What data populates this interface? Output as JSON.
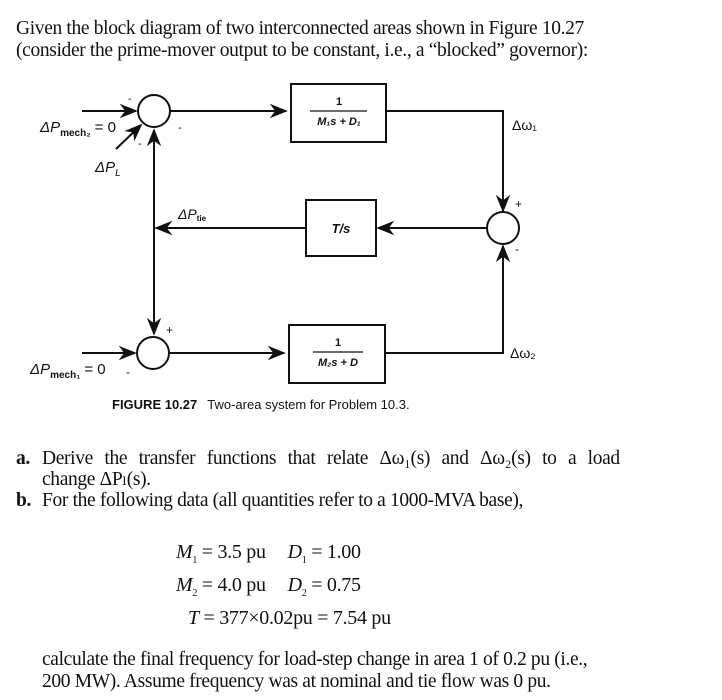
{
  "intro": {
    "line1": "Given the block diagram of two interconnected areas shown in Figure 10.27",
    "line2": "(consider the prime-mover output to be constant, i.e., a “blocked” governor):"
  },
  "diagram": {
    "blocks": {
      "area1": {
        "numerator": "1",
        "denominator": "M₁s + D₁"
      },
      "tie": {
        "label": "T/s"
      },
      "area2": {
        "numerator": "1",
        "denominator": "M₂s + D"
      }
    },
    "signals": {
      "pmech2": "ΔP",
      "pmech2_sub": "mech₂",
      "pmech2_val": "= 0",
      "pload": "ΔP",
      "pload_sub": "L",
      "ptie": "ΔP",
      "ptie_sub": "tie",
      "omega1": "Δω₁",
      "omega2": "Δω₂",
      "pmech1": "ΔP",
      "pmech1_sub": "mech₁",
      "pmech1_val": "= 0"
    },
    "signs": {
      "sum1_top": "-",
      "sum1_right": "-",
      "sum1_bottom": "-",
      "sum_tie_top": "+",
      "sum_tie_bottom": "-",
      "sum2_top": "+",
      "sum2_left": "-"
    }
  },
  "caption": {
    "label": "FIGURE 10.27",
    "text": "Two-area system for Problem 10.3."
  },
  "items": {
    "a": {
      "label": "a.",
      "line1_words": [
        "Derive",
        "the",
        "transfer",
        "functions",
        "that",
        "relate",
        "Δω₁(s)",
        "and",
        "Δω₂(s)",
        "to",
        "a",
        "load"
      ],
      "line2": "change ΔPₗ(s)."
    },
    "b": {
      "label": "b.",
      "line1": "For the following data (all quantities refer to a 1000-MVA base),"
    }
  },
  "equations": {
    "m1": "M",
    "m1_sub": "1",
    "m1_val": " = 3.5 pu",
    "d1": "D",
    "d1_sub": "1",
    "d1_val": " = 1.00",
    "m2": "M",
    "m2_sub": "2",
    "m2_val": " = 4.0 pu",
    "d2": "D",
    "d2_sub": "2",
    "d2_val": " = 0.75",
    "t": "T",
    "t_val": " = 377×0.02pu = 7.54 pu"
  },
  "closing": {
    "line1": "calculate the final frequency for load-step change in area 1 of 0.2 pu (i.e.,",
    "line2": "200 MW). Assume frequency was at nominal and tie flow was 0 pu."
  }
}
